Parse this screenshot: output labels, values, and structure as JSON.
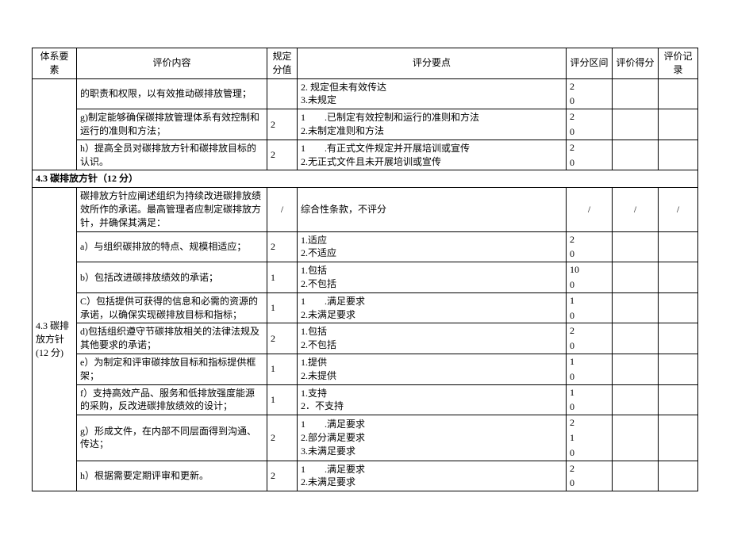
{
  "headers": {
    "sys": "体系要素",
    "content": "评价内容",
    "score": "规定分值",
    "points": "评分要点",
    "range": "评分区间",
    "eval": "评价得分",
    "rec": "评价记录"
  },
  "section_4_3_title": "4.3 碳排放方针（12 分）",
  "section_4_3_label": "4.3 碳排放方针 (12 分)",
  "pre_rows": [
    {
      "content": "的职责和权限，以有效推动碳排放管理；",
      "score": "",
      "points": "2. 规定但未有效传达\n3.未规定",
      "range": [
        "2",
        "0"
      ],
      "eval": "",
      "rec": ""
    },
    {
      "content": "g)制定能够确保碳排放管理体系有效控制和运行的准则和方法；",
      "score": "2",
      "points": "1　　.已制定有效控制和运行的准则和方法\n2.未制定准则和方法",
      "range": [
        "2",
        "0"
      ],
      "eval": "",
      "rec": ""
    },
    {
      "content": "h）提高全员对碳排放方针和碳排放目标的认识。",
      "score": "2",
      "points": "1　　.有正式文件规定并开展培训或宣传\n2.无正式文件且未开展培训或宣传",
      "range": [
        "2",
        "0"
      ],
      "eval": "",
      "rec": ""
    }
  ],
  "rows_4_3": [
    {
      "content": "碳排放方针应阐述组织为持续改进碳排放绩效所作的承诺。最高管理者应制定碳排放方针，并确保其满足：",
      "score": "/",
      "points": "综合性条款，不评分",
      "range_text": "/",
      "eval": "/",
      "rec": "/"
    },
    {
      "content": "a）与组织碳排放的特点、规模相适应；",
      "score": "2",
      "points": "1.适应\n2.不适应",
      "range": [
        "2",
        "0"
      ],
      "eval": "",
      "rec": ""
    },
    {
      "content": "b）包括改进碳排放绩效的承诺；",
      "score": "1",
      "points": "1.包括\n2.不包括",
      "range": [
        "10",
        "0"
      ],
      "eval": "",
      "rec": ""
    },
    {
      "content": "C）包括提供可获得的信息和必需的资源的承诺，以确保实现碳排放目标和指标；",
      "score": "1",
      "points": "1　　.满足要求\n2.未满足要求",
      "range": [
        "1",
        "0"
      ],
      "eval": "",
      "rec": ""
    },
    {
      "content": "d)包括组织遵守节碳排放相关的法律法规及其他要求的承诺；",
      "score": "2",
      "points": "1.包括\n2.不包括",
      "range": [
        "2",
        "0"
      ],
      "eval": "",
      "rec": ""
    },
    {
      "content": "e）为制定和评审碳排放目标和指标提供框架；",
      "score": "1",
      "points": "1.提供\n2.未提供",
      "range": [
        "1",
        "0"
      ],
      "eval": "",
      "rec": ""
    },
    {
      "content": "f）支持高效产品、服务和低排放强度能源的采购，反改进碳排放绩效的设计；",
      "score": "1",
      "points": "1.支持\n2．不支持",
      "range": [
        "1",
        "0"
      ],
      "eval": "",
      "rec": ""
    },
    {
      "content": "g）形成文件，在内部不同层面得到沟通、传达；",
      "score": "2",
      "points": "1　　.满足要求\n2.部分满足要求\n3.未满足要求",
      "range": [
        "2",
        "1",
        "0"
      ],
      "eval": "",
      "rec": ""
    },
    {
      "content": "h）根据需要定期评审和更新。",
      "score": "2",
      "points": "1　　.满足要求\n2.未满足要求",
      "range": [
        "2",
        "0"
      ],
      "eval": "",
      "rec": ""
    }
  ]
}
